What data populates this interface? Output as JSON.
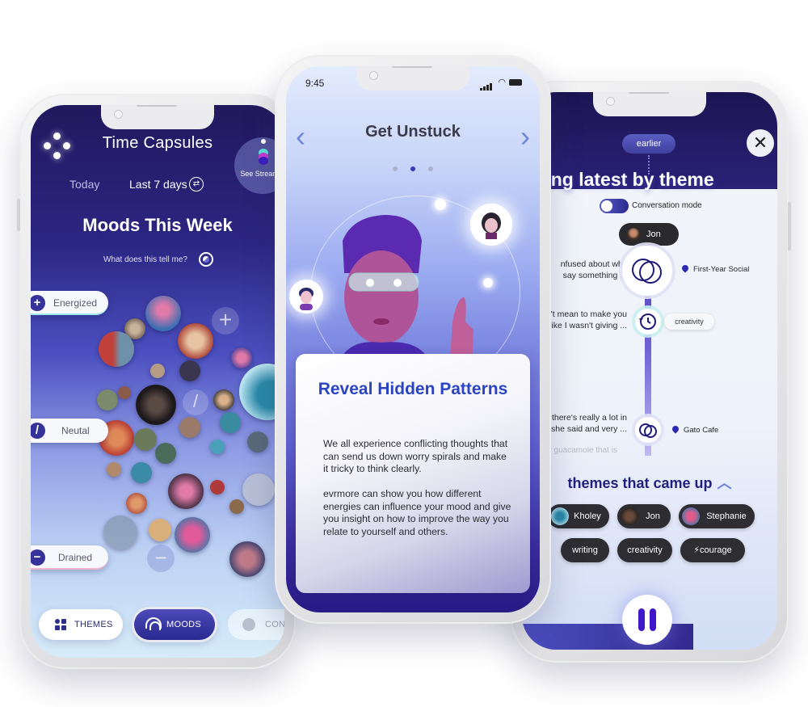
{
  "left_phone": {
    "title": "Time Capsules",
    "see_stream_label": "See Stream",
    "tabs": [
      {
        "label": "Today",
        "active": false
      },
      {
        "label": "Last 7 days",
        "active": true
      }
    ],
    "heading": "Moods This Week",
    "help_link": "What does this tell me?",
    "moods": [
      {
        "label": "Energized",
        "icon": "plus-icon",
        "glyph": "+"
      },
      {
        "label": "Neutal",
        "icon": "slash-icon",
        "glyph": "/"
      },
      {
        "label": "Drained",
        "icon": "minus-icon",
        "glyph": "−"
      }
    ],
    "tabbar": [
      {
        "label": "THEMES",
        "icon": "grid-icon",
        "active": false
      },
      {
        "label": "MOODS",
        "icon": "rainbow-icon",
        "active": true
      },
      {
        "label": "CON",
        "icon": "conversation-icon",
        "active": false
      }
    ]
  },
  "middle_phone": {
    "status_time": "9:45",
    "title": "Get Unstuck",
    "pager": {
      "current": 2,
      "total": 3
    },
    "card": {
      "heading": "Reveal Hidden Patterns",
      "paragraph_1": "We all experience conflicting thoughts that can send us down worry spirals and make it tricky to think clearly.",
      "paragraph_2": "evrmore can show you how different energies can influence your mood and give you insight on how to improve the way you relate to yourself and others."
    }
  },
  "right_phone": {
    "earlier_label": "earlier",
    "title": "Playing latest by theme",
    "conversation_mode_label": "Conversation mode",
    "conversation_mode_on": true,
    "speaker": "Jon",
    "timeline": [
      {
        "snippet_line1": "nfused about why",
        "snippet_line2": "say something ...",
        "icon": "rings-icon",
        "location": "First-Year Social"
      },
      {
        "snippet_line1": "'t mean to make you",
        "snippet_line2": "like I wasn't giving ...",
        "icon": "history-icon",
        "tag": "creativity"
      },
      {
        "snippet_line1": "there's really a lot in",
        "snippet_line2": "she said and very ...",
        "icon": "rings-icon",
        "location": "Gato Cafe"
      },
      {
        "snippet_line1": "nly guacamole that is",
        "snippet_line2": "",
        "icon": "rings-icon"
      }
    ],
    "themes_heading": "themes that came up",
    "people_chips": [
      "Kholey",
      "Jon",
      "Stephanie"
    ],
    "topic_chips": [
      "writing",
      "creativity",
      "⚡courage"
    ],
    "playback_state": "playing"
  },
  "colors": {
    "brand_indigo": "#2a2990",
    "heading_blue": "#2a44c2",
    "chip_dark": "#2d2d32",
    "pause_purple": "#3f16c8"
  }
}
